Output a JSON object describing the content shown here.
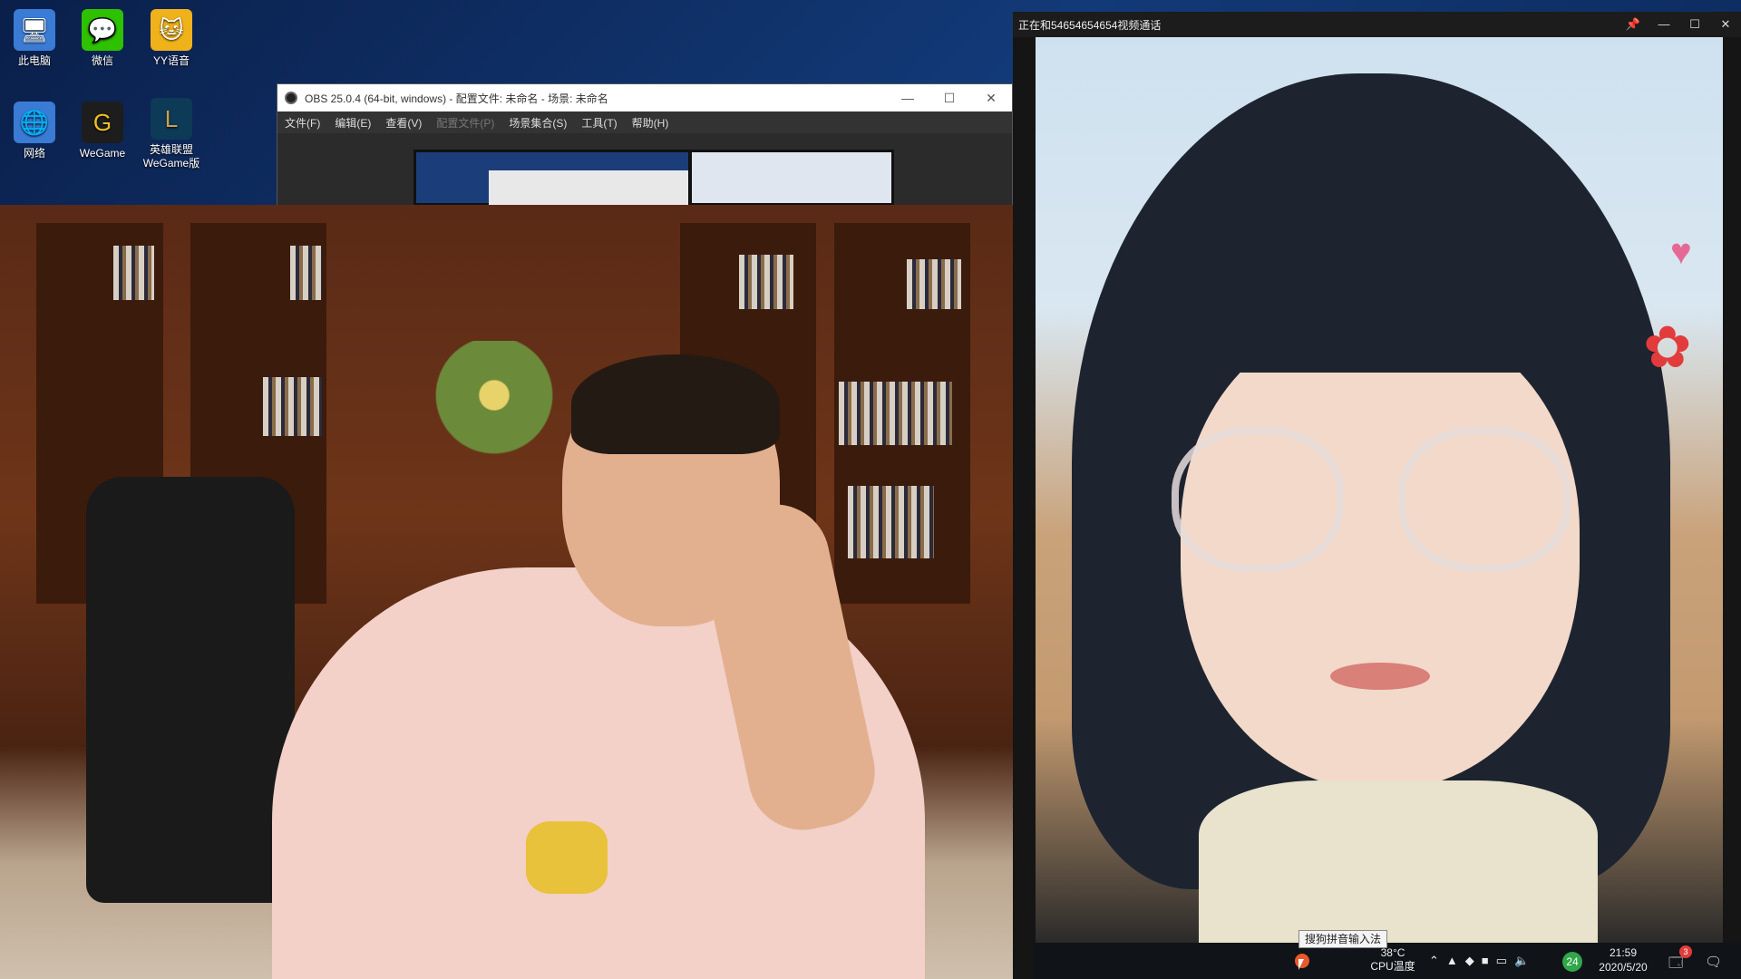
{
  "desktop": {
    "icons": [
      {
        "label": "此电脑",
        "icon": "computer-icon"
      },
      {
        "label": "微信",
        "icon": "wechat-icon"
      },
      {
        "label": "YY语音",
        "icon": "yy-icon"
      },
      {
        "label": "网络",
        "icon": "network-icon"
      },
      {
        "label": "WeGame",
        "icon": "wegame-icon"
      },
      {
        "label": "英雄联盟\nWeGame版",
        "icon": "lol-icon"
      }
    ]
  },
  "obs": {
    "title": "OBS 25.0.4 (64-bit, windows) - 配置文件: 未命名 - 场景: 未命名",
    "menu": [
      "文件(F)",
      "编辑(E)",
      "查看(V)",
      "配置文件(P)",
      "场景集合(S)",
      "工具(T)",
      "帮助(H)"
    ]
  },
  "call": {
    "title": "正在和54654654654视频通话"
  },
  "taskbar": {
    "tooltip": "搜狗拼音输入法",
    "temperature": "38°C",
    "temperature_label": "CPU温度",
    "badge": "24",
    "time": "21:59",
    "date": "2020/5/20",
    "notification_count": "3"
  },
  "colors": {
    "desktop_bg": "#0d2a5c",
    "obs_bg": "#2b2b2b",
    "call_bg": "#151515",
    "badge_green": "#2fa74a",
    "notif_red": "#e23b3b"
  }
}
